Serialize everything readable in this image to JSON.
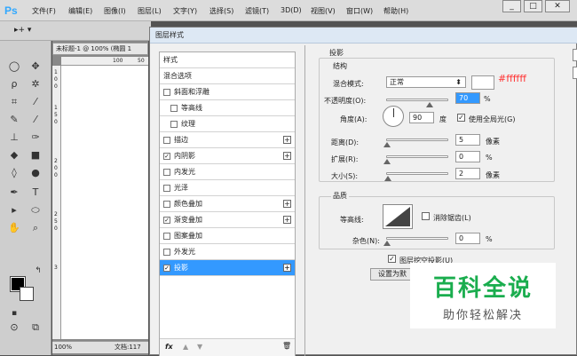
{
  "app": {
    "logo": "Ps"
  },
  "menubar": {
    "items": [
      "文件(F)",
      "编辑(E)",
      "图像(I)",
      "图层(L)",
      "文字(Y)",
      "选择(S)",
      "滤镜(T)",
      "3D(D)",
      "视图(V)",
      "窗口(W)",
      "帮助(H)"
    ],
    "window_buttons": [
      "_",
      "□",
      "✕"
    ]
  },
  "options": {
    "tool_glyph": "▸+ ▾"
  },
  "document": {
    "tab_title": "未标题-1 @ 100% (椭圆 1",
    "ruler_h": [
      "100",
      "50"
    ],
    "ruler_v": [
      "1",
      "0",
      "0",
      "1",
      "5",
      "0",
      "2",
      "0",
      "0",
      "2",
      "5",
      "0",
      "3"
    ],
    "zoom": "100%",
    "status": "文档:117"
  },
  "dialog": {
    "title": "图层样式",
    "style_list": [
      {
        "label": "样式",
        "checkbox": false,
        "plus": false,
        "checked": false
      },
      {
        "label": "混合选项",
        "checkbox": false,
        "plus": false,
        "checked": false
      },
      {
        "label": "斜面和浮雕",
        "checkbox": true,
        "plus": false,
        "checked": false
      },
      {
        "label": "等高线",
        "checkbox": true,
        "plus": false,
        "checked": false,
        "indent": true
      },
      {
        "label": "纹理",
        "checkbox": true,
        "plus": false,
        "checked": false,
        "indent": true
      },
      {
        "label": "描边",
        "checkbox": true,
        "plus": true,
        "checked": false
      },
      {
        "label": "内阴影",
        "checkbox": true,
        "plus": true,
        "checked": true
      },
      {
        "label": "内发光",
        "checkbox": true,
        "plus": false,
        "checked": false
      },
      {
        "label": "光泽",
        "checkbox": true,
        "plus": false,
        "checked": false
      },
      {
        "label": "颜色叠加",
        "checkbox": true,
        "plus": true,
        "checked": false
      },
      {
        "label": "渐变叠加",
        "checkbox": true,
        "plus": true,
        "checked": true
      },
      {
        "label": "图案叠加",
        "checkbox": true,
        "plus": false,
        "checked": false
      },
      {
        "label": "外发光",
        "checkbox": true,
        "plus": false,
        "checked": false
      },
      {
        "label": "投影",
        "checkbox": true,
        "plus": true,
        "checked": true,
        "selected": true
      }
    ],
    "footer_icons": [
      "fx",
      "▲",
      "▼",
      "🗑"
    ],
    "shadow": {
      "section_title": "投影",
      "structure_title": "结构",
      "blend_mode_label": "混合模式:",
      "blend_mode_value": "正常",
      "color_annotation": "#ffffff",
      "opacity_label": "不透明度(O):",
      "opacity_value": "70",
      "opacity_fraction": 0.7,
      "percent": "%",
      "angle_label": "角度(A):",
      "angle_value": "90",
      "degree_unit": "度",
      "global_light_label": "使用全局光(G)",
      "distance_label": "距离(D):",
      "distance_value": "5",
      "pixel_unit": "像素",
      "spread_label": "扩展(R):",
      "spread_value": "0",
      "size_label": "大小(S):",
      "size_value": "2",
      "quality_title": "品质",
      "contour_label": "等高线:",
      "antialias_label": "消除锯齿(L)",
      "noise_label": "杂色(N):",
      "noise_value": "0",
      "knockout_label": "图层挖空投影(U)",
      "default_button": "设置为默"
    }
  },
  "watermark": {
    "big": "百科全说",
    "small": "助你轻松解决"
  },
  "colors": {
    "selected": "#3399ff",
    "annotation_red": "#ff3333",
    "watermark_green": "#1aad4e"
  }
}
